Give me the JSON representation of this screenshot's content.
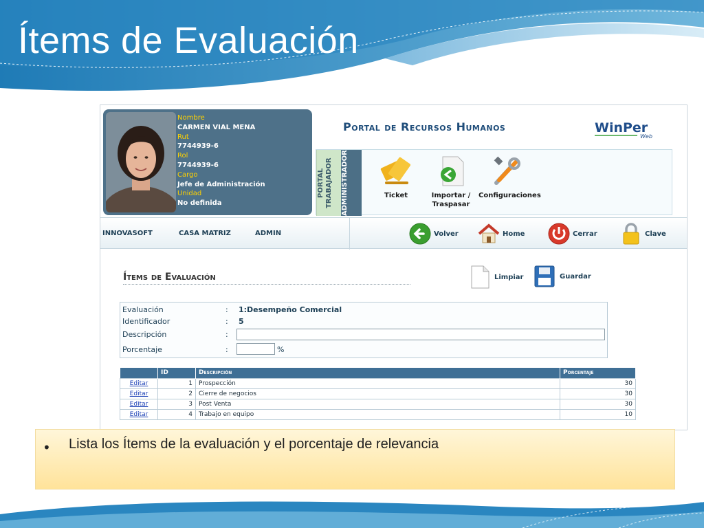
{
  "slide": {
    "title": "Ítems de Evaluación",
    "caption": "Lista los Ítems de la evaluación y el porcentaje de relevancia",
    "bullet": "•"
  },
  "profile": {
    "fields": [
      {
        "label": "Nombre",
        "value": "CARMEN VIAL MENA"
      },
      {
        "label": "Rut",
        "value": "7744939-6"
      },
      {
        "label": "Rol",
        "value": "7744939-6"
      },
      {
        "label": "Cargo",
        "value": "Jefe de Administración"
      },
      {
        "label": "Unidad",
        "value": "No definida"
      }
    ]
  },
  "header": {
    "portal_title": "Portal de Recursos Humanos",
    "logo_text": "WinPer",
    "logo_sub": "Web"
  },
  "roles": {
    "portal_label": "PORTAL TRABAJADOR",
    "admin_label": "ADMINISTRADOR"
  },
  "tools": [
    {
      "label": "Ticket",
      "icon": "ticket-icon"
    },
    {
      "label": "Importar / Traspasar",
      "icon": "import-icon"
    },
    {
      "label": "Configuraciones",
      "icon": "tools-icon"
    }
  ],
  "nav": {
    "company": "INNOVASOFT",
    "branch": "CASA MATRIZ",
    "user": "ADMIN",
    "buttons": [
      {
        "label": "Volver",
        "icon": "back-icon"
      },
      {
        "label": "Home",
        "icon": "home-icon"
      },
      {
        "label": "Cerrar",
        "icon": "power-icon"
      },
      {
        "label": "Clave",
        "icon": "lock-icon"
      }
    ]
  },
  "page": {
    "title": "Ítems de Evaluación",
    "clear_label": "Limpiar",
    "save_label": "Guardar"
  },
  "form": {
    "evaluacion_label": "Evaluación",
    "evaluacion_value": "1:Desempeño Comercial",
    "identificador_label": "Identificador",
    "identificador_value": "5",
    "descripcion_label": "Descripción",
    "descripcion_value": "",
    "porcentaje_label": "Porcentaje",
    "porcentaje_value": "",
    "porcentaje_unit": "%",
    "colon": ":"
  },
  "table": {
    "headers": [
      "",
      "ID",
      "Descripción",
      "Porcentaje"
    ],
    "edit_label": "Editar",
    "rows": [
      {
        "id": "1",
        "descripcion": "Prospección",
        "porcentaje": "30"
      },
      {
        "id": "2",
        "descripcion": "Cierre de negocios",
        "porcentaje": "30"
      },
      {
        "id": "3",
        "descripcion": "Post Venta",
        "porcentaje": "30"
      },
      {
        "id": "4",
        "descripcion": "Trabajo en equipo",
        "porcentaje": "10"
      }
    ]
  },
  "colors": {
    "accent": "#3f6f95",
    "profile_bg": "#4e7189",
    "label_yellow": "#ffd200"
  }
}
